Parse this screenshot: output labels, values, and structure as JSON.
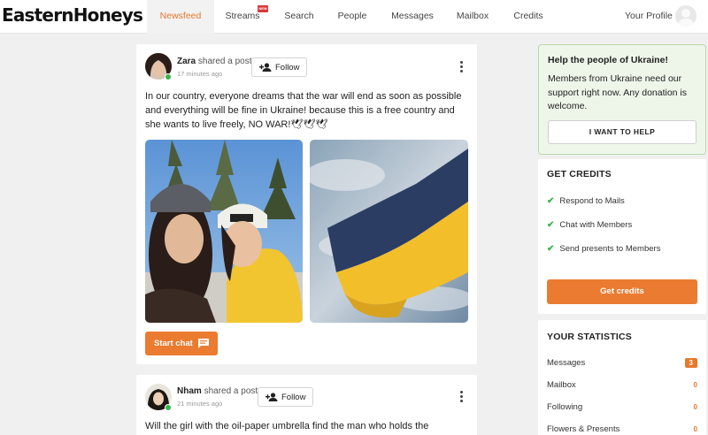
{
  "header": {
    "logo": "EasternHoneys",
    "nav": [
      {
        "label": "Newsfeed",
        "active": true
      },
      {
        "label": "Streams",
        "badge": "NEW"
      },
      {
        "label": "Search"
      },
      {
        "label": "People"
      },
      {
        "label": "Messages"
      },
      {
        "label": "Mailbox"
      },
      {
        "label": "Credits"
      }
    ],
    "profile_label": "Your Profile",
    "profile_icon": "user-avatar-icon"
  },
  "posts": [
    {
      "author": "Zara",
      "action": "shared a post",
      "time": "17 minutes ago",
      "follow_label": "Follow",
      "text": "In our country, everyone dreams that the war will end as soon as possible and everything will be fine in Ukraine! because this is a free country and she wants to live freely, NO WAR!🕊🕊🕊",
      "start_chat_label": "Start chat",
      "online": true
    },
    {
      "author": "Nham",
      "action": "shared a post",
      "time": "21 minutes ago",
      "follow_label": "Follow",
      "text": "Will the girl with the oil-paper umbrella find the man who holds the",
      "online": true
    }
  ],
  "ukraine": {
    "title": "Help the people of Ukraine!",
    "text": "Members from Ukraine need our support right now. Any donation is welcome.",
    "button": "I WANT TO HELP"
  },
  "credits": {
    "title": "GET CREDITS",
    "items": [
      "Respond to Mails",
      "Chat with Members",
      "Send presents to Members"
    ],
    "button": "Get credits"
  },
  "statistics": {
    "title": "YOUR STATISTICS",
    "rows": [
      {
        "label": "Messages",
        "value": "3"
      },
      {
        "label": "Mailbox",
        "value": "0"
      },
      {
        "label": "Following",
        "value": "0"
      },
      {
        "label": "Flowers & Presents",
        "value": "0"
      }
    ]
  },
  "colors": {
    "accent": "#ea7b30",
    "online": "#3bb54a",
    "ukraine_bg": "#eef6ea",
    "ukraine_border": "#b8dbaa"
  }
}
